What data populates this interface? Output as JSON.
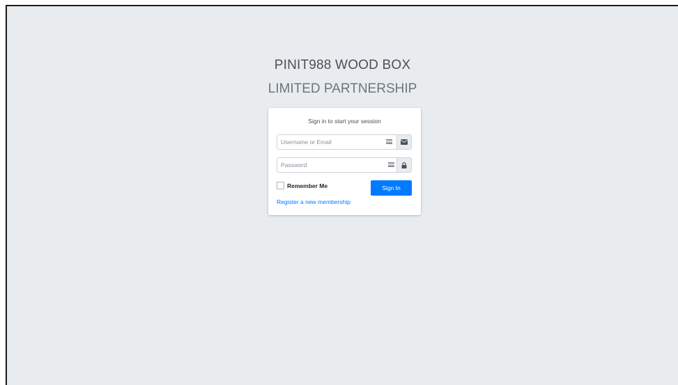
{
  "brand": {
    "line1": "PINIT988 WOOD BOX",
    "line2": "LIMITED PARTNERSHIP"
  },
  "login": {
    "message": "Sign in to start your session",
    "username_placeholder": "Username or Email",
    "username_value": "",
    "password_placeholder": "Password",
    "password_value": "",
    "remember_label": "Remember Me",
    "remember_checked": false,
    "signin_label": "Sign In",
    "register_label": "Register a new membership"
  },
  "icons": {
    "username_addon": "envelope-icon",
    "password_addon": "lock-icon",
    "autofill": "password-manager-key-icon"
  },
  "colors": {
    "background": "#e9ecef",
    "primary": "#007bff",
    "card": "#ffffff"
  }
}
